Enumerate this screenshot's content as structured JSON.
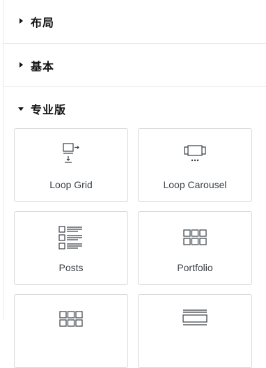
{
  "sections": [
    {
      "title": "布局",
      "expanded": false
    },
    {
      "title": "基本",
      "expanded": false
    },
    {
      "title": "专业版",
      "expanded": true
    }
  ],
  "widgets": [
    {
      "label": "Loop Grid",
      "icon": "loop-grid-icon"
    },
    {
      "label": "Loop Carousel",
      "icon": "loop-carousel-icon"
    },
    {
      "label": "Posts",
      "icon": "posts-icon"
    },
    {
      "label": "Portfolio",
      "icon": "portfolio-icon"
    },
    {
      "label": "",
      "icon": "gallery-icon"
    },
    {
      "label": "",
      "icon": "form-icon"
    }
  ],
  "colors": {
    "icon": "#3a3f45",
    "border": "#d5d8dc",
    "divider": "#e6e8ea"
  }
}
